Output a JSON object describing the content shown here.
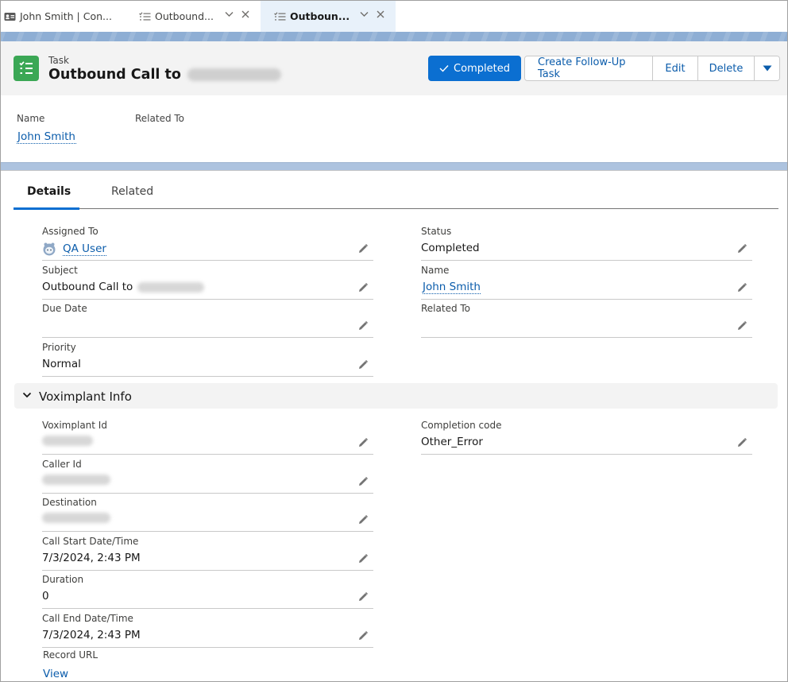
{
  "tabs": [
    {
      "label": "John Smith | Con...",
      "icon": "contact-card-icon",
      "active": false
    },
    {
      "label": "Outbound...",
      "icon": "task-list-icon",
      "active": false
    },
    {
      "label": "Outboun...",
      "icon": "task-list-icon",
      "active": true
    }
  ],
  "header": {
    "object_label": "Task",
    "title": "Outbound Call to",
    "title_redacted": true,
    "icon": "task-icon",
    "brand_color": "#3ba755"
  },
  "actions": {
    "completed": "Completed",
    "create_follow_up": "Create Follow-Up Task",
    "edit": "Edit",
    "delete": "Delete",
    "more_icon": "caret-down-icon"
  },
  "highlights": {
    "name_label": "Name",
    "name_value": "John Smith",
    "related_label": "Related To",
    "related_value": ""
  },
  "detail_tabs": {
    "details": "Details",
    "related": "Related",
    "active": "Details"
  },
  "fields": {
    "assigned_to": {
      "label": "Assigned To",
      "value": "QA User"
    },
    "subject": {
      "label": "Subject",
      "value": "Outbound Call to"
    },
    "due_date": {
      "label": "Due Date",
      "value": ""
    },
    "priority": {
      "label": "Priority",
      "value": "Normal"
    },
    "status": {
      "label": "Status",
      "value": "Completed"
    },
    "name": {
      "label": "Name",
      "value": "John Smith"
    },
    "related_to": {
      "label": "Related To",
      "value": ""
    }
  },
  "voximplant": {
    "section_title": "Voximplant Info",
    "voximplant_id": {
      "label": "Voximplant Id",
      "value": ""
    },
    "caller_id": {
      "label": "Caller Id",
      "value": ""
    },
    "destination": {
      "label": "Destination",
      "value": ""
    },
    "call_start": {
      "label": "Call Start Date/Time",
      "value": "7/3/2024, 2:43 PM"
    },
    "duration": {
      "label": "Duration",
      "value": "0"
    },
    "call_end": {
      "label": "Call End Date/Time",
      "value": "7/3/2024, 2:43 PM"
    },
    "record_url": {
      "label": "Record URL",
      "value": "View"
    },
    "completion_code": {
      "label": "Completion code",
      "value": "Other_Error"
    }
  },
  "colors": {
    "brand_blue": "#0b6fd1",
    "link_blue": "#0b5cab",
    "banner": "#8eaed4"
  }
}
